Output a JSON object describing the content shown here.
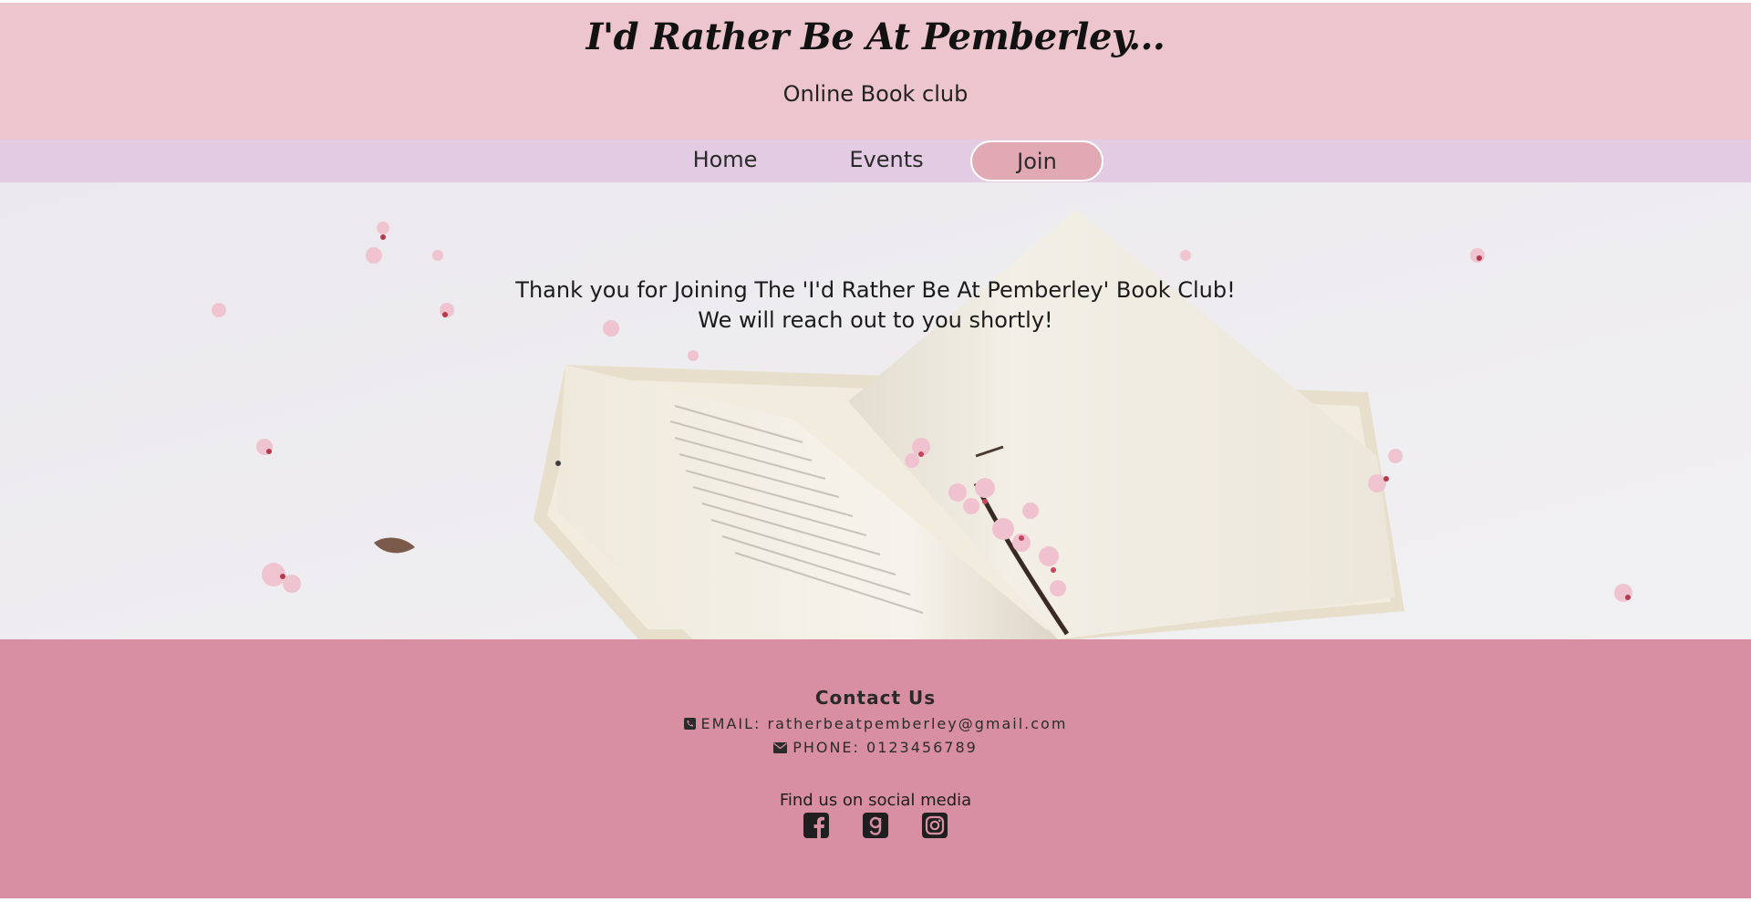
{
  "header": {
    "title": "I'd Rather Be At Pemberley...",
    "subtitle": "Online Book club"
  },
  "nav": {
    "items": [
      {
        "label": "Home"
      },
      {
        "label": "Events"
      },
      {
        "label": "Join"
      }
    ],
    "active": "Join"
  },
  "hero": {
    "line1": "Thank you for Joining The 'I'd Rather Be At Pemberley' Book Club!",
    "line2": "We will reach out to you shortly!"
  },
  "footer": {
    "contact_heading": "Contact Us",
    "email_text": "EMAIL: ratherbeatpemberley@gmail.com",
    "phone_text": "PHONE: 0123456789",
    "email_icon": "phone-square-icon",
    "phone_icon": "envelope-icon",
    "social_heading": "Find us on social media",
    "social_icons": [
      "facebook-icon",
      "goodreads-icon",
      "instagram-icon"
    ]
  },
  "colors": {
    "header_bg": "#edc5cd",
    "nav_bg": "#e4cbe4",
    "nav_active_bg": "#e1a9b3",
    "footer_bg": "#d88fa1"
  }
}
